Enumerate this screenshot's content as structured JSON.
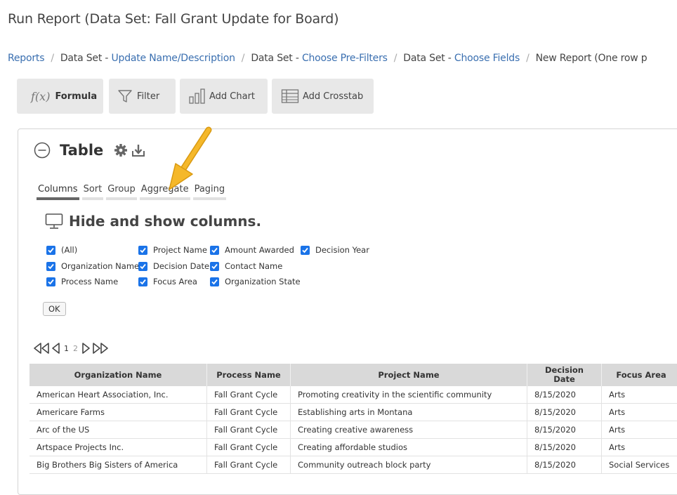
{
  "page": {
    "title": "Run Report (Data Set: Fall Grant Update for Board)"
  },
  "breadcrumb": {
    "reports": "Reports",
    "ds_prefix_1": "Data Set - ",
    "update_name": "Update Name/Description",
    "ds_prefix_2": "Data Set - ",
    "choose_prefilters": "Choose Pre-Filters",
    "ds_prefix_3": "Data Set - ",
    "choose_fields": "Choose Fields",
    "current": "New Report (One row p"
  },
  "toolbar": {
    "formula_icon": "f(x)",
    "formula": "Formula",
    "filter": "Filter",
    "add_chart": "Add Chart",
    "add_crosstab": "Add Crosstab"
  },
  "table_panel": {
    "title": "Table",
    "tabs": [
      "Columns",
      "Sort",
      "Group",
      "Aggregate",
      "Paging"
    ],
    "active_tab": "Columns",
    "hide_show_title": "Hide and show columns.",
    "columns": [
      {
        "label": "(All)",
        "checked": true
      },
      {
        "label": "Organization Name",
        "checked": true
      },
      {
        "label": "Process Name",
        "checked": true
      },
      {
        "label": "Project Name",
        "checked": true
      },
      {
        "label": "Decision Date",
        "checked": true
      },
      {
        "label": "Focus Area",
        "checked": true
      },
      {
        "label": "Amount Awarded",
        "checked": true
      },
      {
        "label": "Contact Name",
        "checked": true
      },
      {
        "label": "Organization State",
        "checked": true
      },
      {
        "label": "Decision Year",
        "checked": true
      }
    ],
    "ok": "OK",
    "pager": {
      "current": "1",
      "next": "2"
    }
  },
  "grid": {
    "headers": [
      "Organization Name",
      "Process Name",
      "Project Name",
      "Decision\nDate",
      "Focus Area"
    ],
    "rows": [
      [
        "American Heart Association, Inc.",
        "Fall Grant Cycle",
        "Promoting creativity in the scientific community",
        "8/15/2020",
        "Arts"
      ],
      [
        "Americare Farms",
        "Fall Grant Cycle",
        "Establishing arts in Montana",
        "8/15/2020",
        "Arts"
      ],
      [
        "Arc of the US",
        "Fall Grant Cycle",
        "Creating creative awareness",
        "8/15/2020",
        "Arts"
      ],
      [
        "Artspace Projects Inc.",
        "Fall Grant Cycle",
        "Creating affordable studios",
        "8/15/2020",
        "Arts"
      ],
      [
        "Big Brothers Big Sisters of America",
        "Fall Grant Cycle",
        "Community outreach block party",
        "8/15/2020",
        "Social Services"
      ]
    ]
  },
  "colors": {
    "link": "#3a6fb0",
    "checkbox": "#1a73e8",
    "button_bg": "#e8e8e8",
    "arrow": "#f2b01e"
  }
}
